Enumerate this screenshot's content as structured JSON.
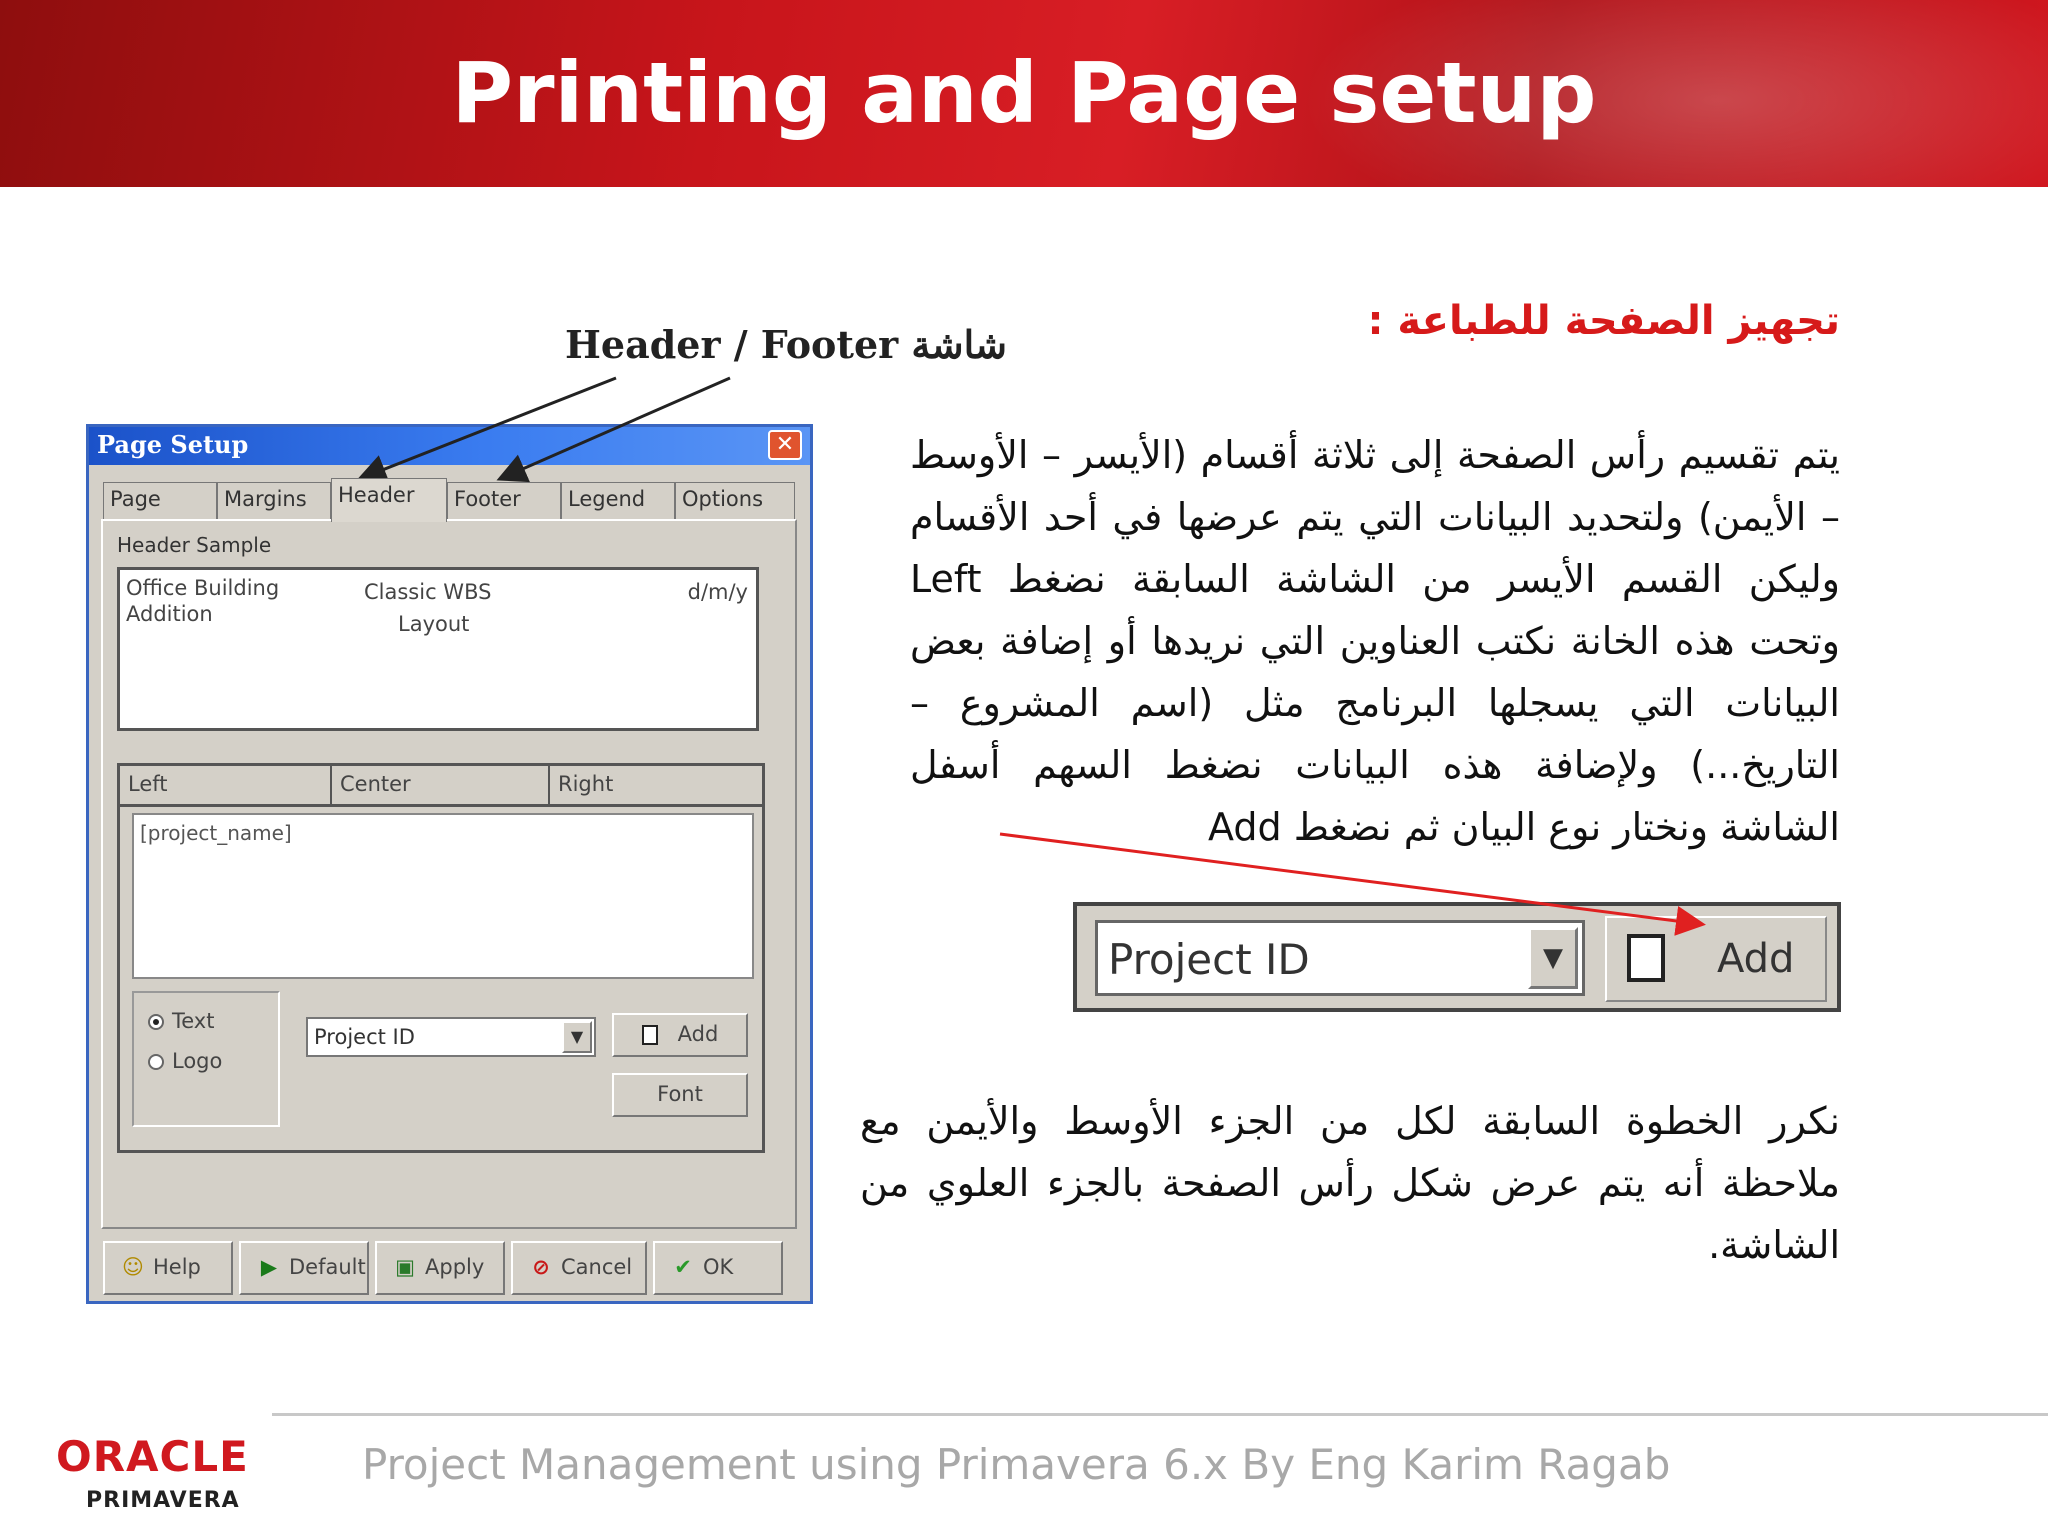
{
  "slide": {
    "title": "Printing and Page setup",
    "annotation_label": "Header / Footer شاشة",
    "heading": "تجهيز الصفحة للطباعة :",
    "paragraph1": "يتم تقسيم رأس الصفحة إلى ثلاثة أقسام (الأيسر – الأوسط – الأيمن) ولتحديد البيانات التي يتم عرضها في أحد الأقسام وليكن القسم الأيسر من الشاشة السابقة نضغط Left وتحت هذه الخانة نكتب العناوين التي نريدها أو إضافة بعض البيانات التي يسجلها البرنامج مثل (اسم المشروع – التاريخ...) ولإضافة هذه البيانات نضغط السهم أسفل الشاشة ونختار نوع البيان ثم نضغط Add",
    "paragraph2": "نكرر الخطوة السابقة لكل من الجزء الأوسط والأيمن مع ملاحظة أنه يتم عرض شكل رأس الصفحة بالجزء العلوي من الشاشة.",
    "zoom": {
      "combo_value": "Project ID",
      "add_label": "Add"
    },
    "footer": {
      "logo_text": "ORACLE",
      "logo_sub": "PRIMAVERA",
      "text": "Project Management using Primavera 6.x By Eng Karim Ragab"
    },
    "colors": {
      "banner": "#c8151b",
      "heading": "#d61a1a",
      "arrow": "#e02020"
    }
  },
  "dialog": {
    "title": "Page Setup",
    "close_label": "✕",
    "tabs": [
      {
        "label": "Page"
      },
      {
        "label": "Margins"
      },
      {
        "label": "Header"
      },
      {
        "label": "Footer"
      },
      {
        "label": "Legend"
      },
      {
        "label": "Options"
      }
    ],
    "active_tab": "Header",
    "sample_label": "Header Sample",
    "sample": {
      "left_line1": "Office Building",
      "left_line2": "Addition",
      "center_line1": "Classic WBS",
      "center_line2": "Layout",
      "right": "d/m/y"
    },
    "sections": [
      {
        "label": "Left"
      },
      {
        "label": "Center"
      },
      {
        "label": "Right"
      }
    ],
    "editor_value": "[project_name]",
    "radio_text": "Text",
    "radio_logo": "Logo",
    "combo_value": "Project ID",
    "add_label": "Add",
    "font_label": "Font",
    "buttons": [
      {
        "label": "Help",
        "icon": "help-icon"
      },
      {
        "label": "Default",
        "icon": "play-icon"
      },
      {
        "label": "Apply",
        "icon": "apply-icon"
      },
      {
        "label": "Cancel",
        "icon": "cancel-icon"
      },
      {
        "label": "OK",
        "icon": "check-icon"
      }
    ]
  }
}
